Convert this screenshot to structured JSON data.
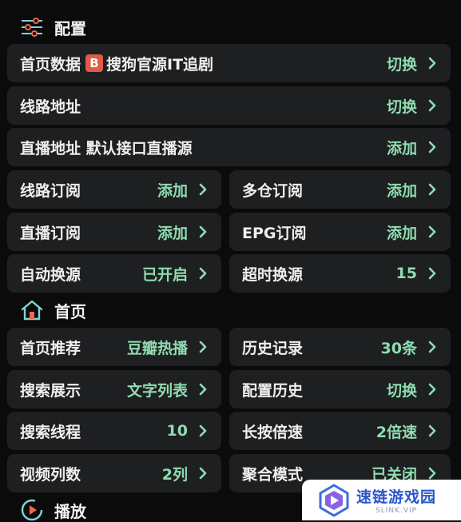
{
  "sections": {
    "config": "配置",
    "home": "首页",
    "play": "播放"
  },
  "config": {
    "home_data": {
      "label": "首页数据",
      "badge": "B",
      "source": "搜狗官源IT追剧",
      "value": "切换"
    },
    "route_address": {
      "label": "线路地址",
      "value": "切换"
    },
    "live_address": {
      "label": "直播地址 默认接口直播源",
      "value": "添加"
    },
    "route_sub": {
      "label": "线路订阅",
      "value": "添加"
    },
    "multi_repo": {
      "label": "多仓订阅",
      "value": "添加"
    },
    "live_sub": {
      "label": "直播订阅",
      "value": "添加"
    },
    "epg_sub": {
      "label": "EPG订阅",
      "value": "添加"
    },
    "auto_switch": {
      "label": "自动换源",
      "value": "已开启"
    },
    "timeout_switch": {
      "label": "超时换源",
      "value": "15"
    }
  },
  "home": {
    "recommend": {
      "label": "首页推荐",
      "value": "豆瓣热播"
    },
    "history": {
      "label": "历史记录",
      "value": "30条"
    },
    "search_display": {
      "label": "搜索展示",
      "value": "文字列表"
    },
    "config_history": {
      "label": "配置历史",
      "value": "切换"
    },
    "search_threads": {
      "label": "搜索线程",
      "value": "10"
    },
    "long_press": {
      "label": "长按倍速",
      "value": "2倍速"
    },
    "video_columns": {
      "label": "视频列数",
      "value": "2列"
    },
    "aggregate": {
      "label": "聚合模式",
      "value": "已关闭"
    }
  },
  "watermark": {
    "name": "速链游戏园",
    "sub": "SLINK.VIP"
  },
  "colors": {
    "accent": "#8fdcb0",
    "row_bg": "#1e1f21",
    "badge": "#e25a48"
  },
  "icons": {
    "config": "sliders-icon",
    "home": "home-icon",
    "play": "play-circle-icon",
    "chevron": "chevron-right-icon"
  }
}
